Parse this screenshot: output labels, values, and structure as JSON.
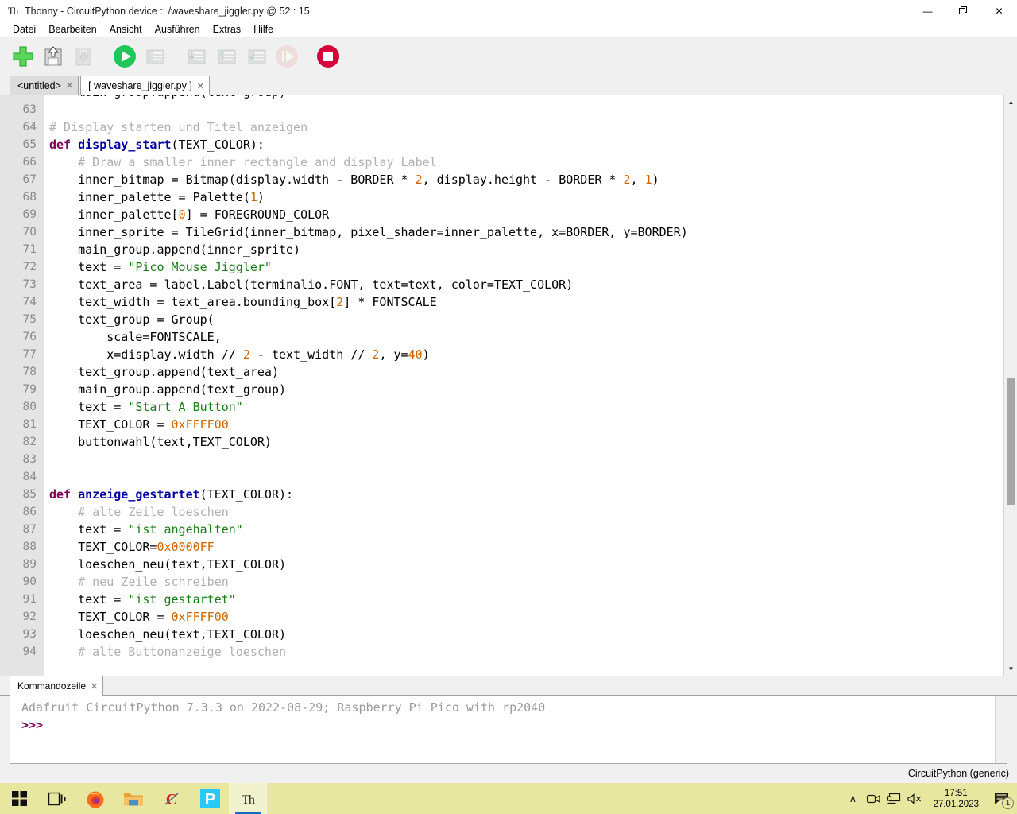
{
  "window": {
    "title": "Thonny  -  CircuitPython device :: /waveshare_jiggler.py  @  52 : 15",
    "app_icon": "thonny-icon",
    "minimize": "—",
    "maximize": "❐",
    "close": "✕"
  },
  "menu": {
    "items": [
      {
        "label": "Datei"
      },
      {
        "label": "Bearbeiten"
      },
      {
        "label": "Ansicht"
      },
      {
        "label": "Ausführen"
      },
      {
        "label": "Extras"
      },
      {
        "label": "Hilfe"
      }
    ]
  },
  "toolbar": {
    "buttons": [
      {
        "name": "new-file-button",
        "icon": "plus-icon",
        "enabled": true
      },
      {
        "name": "open-file-button",
        "icon": "folder-open-icon",
        "enabled": true
      },
      {
        "name": "save-file-button",
        "icon": "save-icon",
        "enabled": false
      },
      {
        "name": "run-button",
        "icon": "play-icon",
        "enabled": true
      },
      {
        "name": "debug-button",
        "icon": "debug-icon",
        "enabled": false
      },
      {
        "name": "step-over-button",
        "icon": "step-over-icon",
        "enabled": false
      },
      {
        "name": "step-into-button",
        "icon": "step-into-icon",
        "enabled": false
      },
      {
        "name": "step-out-button",
        "icon": "step-out-icon",
        "enabled": false
      },
      {
        "name": "resume-button",
        "icon": "resume-icon",
        "enabled": false
      },
      {
        "name": "stop-button",
        "icon": "stop-icon",
        "enabled": true
      }
    ]
  },
  "editor": {
    "tabs": [
      {
        "label": "<untitled>",
        "active": false,
        "close": "✕"
      },
      {
        "label": "[ waveshare_jiggler.py ]",
        "active": true,
        "close": "✕"
      }
    ],
    "first_line_number": 63,
    "clipped_top_line": "    main_group.append(text_group)",
    "lines": [
      {
        "n": 63,
        "tokens": []
      },
      {
        "n": 64,
        "tokens": [
          {
            "t": "# Display starten und Titel anzeigen",
            "c": "cm"
          }
        ]
      },
      {
        "n": 65,
        "tokens": [
          {
            "t": "def ",
            "c": "kw"
          },
          {
            "t": "display_start",
            "c": "fn"
          },
          {
            "t": "(TEXT_COLOR):",
            "c": ""
          }
        ]
      },
      {
        "n": 66,
        "tokens": [
          {
            "t": "    # Draw a smaller inner rectangle and display Label",
            "c": "cm"
          }
        ]
      },
      {
        "n": 67,
        "tokens": [
          {
            "t": "    inner_bitmap = Bitmap(display.width - BORDER * ",
            "c": ""
          },
          {
            "t": "2",
            "c": "nu"
          },
          {
            "t": ", display.height - BORDER * ",
            "c": ""
          },
          {
            "t": "2",
            "c": "nu"
          },
          {
            "t": ", ",
            "c": ""
          },
          {
            "t": "1",
            "c": "nu"
          },
          {
            "t": ")",
            "c": ""
          }
        ]
      },
      {
        "n": 68,
        "tokens": [
          {
            "t": "    inner_palette = Palette(",
            "c": ""
          },
          {
            "t": "1",
            "c": "nu"
          },
          {
            "t": ")",
            "c": ""
          }
        ]
      },
      {
        "n": 69,
        "tokens": [
          {
            "t": "    inner_palette[",
            "c": ""
          },
          {
            "t": "0",
            "c": "nu"
          },
          {
            "t": "] = FOREGROUND_COLOR",
            "c": ""
          }
        ]
      },
      {
        "n": 70,
        "tokens": [
          {
            "t": "    inner_sprite = TileGrid(inner_bitmap, pixel_shader=inner_palette, x=BORDER, y=BORDER)",
            "c": ""
          }
        ]
      },
      {
        "n": 71,
        "tokens": [
          {
            "t": "    main_group.append(inner_sprite)",
            "c": ""
          }
        ]
      },
      {
        "n": 72,
        "tokens": [
          {
            "t": "    text = ",
            "c": ""
          },
          {
            "t": "\"Pico Mouse Jiggler\"",
            "c": "st"
          }
        ]
      },
      {
        "n": 73,
        "tokens": [
          {
            "t": "    text_area = label.Label(terminalio.FONT, text=text, color=TEXT_COLOR)",
            "c": ""
          }
        ]
      },
      {
        "n": 74,
        "tokens": [
          {
            "t": "    text_width = text_area.bounding_box[",
            "c": ""
          },
          {
            "t": "2",
            "c": "nu"
          },
          {
            "t": "] * FONTSCALE",
            "c": ""
          }
        ]
      },
      {
        "n": 75,
        "tokens": [
          {
            "t": "    text_group = Group(",
            "c": ""
          }
        ]
      },
      {
        "n": 76,
        "tokens": [
          {
            "t": "        scale=FONTSCALE,",
            "c": ""
          }
        ]
      },
      {
        "n": 77,
        "tokens": [
          {
            "t": "        x=display.width // ",
            "c": ""
          },
          {
            "t": "2",
            "c": "nu"
          },
          {
            "t": " - text_width // ",
            "c": ""
          },
          {
            "t": "2",
            "c": "nu"
          },
          {
            "t": ", y=",
            "c": ""
          },
          {
            "t": "40",
            "c": "nu"
          },
          {
            "t": ")",
            "c": ""
          }
        ]
      },
      {
        "n": 78,
        "tokens": [
          {
            "t": "    text_group.append(text_area)",
            "c": ""
          }
        ]
      },
      {
        "n": 79,
        "tokens": [
          {
            "t": "    main_group.append(text_group)",
            "c": ""
          }
        ]
      },
      {
        "n": 80,
        "tokens": [
          {
            "t": "    text = ",
            "c": ""
          },
          {
            "t": "\"Start A Button\"",
            "c": "st"
          }
        ]
      },
      {
        "n": 81,
        "tokens": [
          {
            "t": "    TEXT_COLOR = ",
            "c": ""
          },
          {
            "t": "0xFFFF00",
            "c": "nu"
          }
        ]
      },
      {
        "n": 82,
        "tokens": [
          {
            "t": "    buttonwahl(text,TEXT_COLOR)",
            "c": ""
          }
        ]
      },
      {
        "n": 83,
        "tokens": []
      },
      {
        "n": 84,
        "tokens": []
      },
      {
        "n": 85,
        "tokens": [
          {
            "t": "def ",
            "c": "kw"
          },
          {
            "t": "anzeige_gestartet",
            "c": "fn"
          },
          {
            "t": "(TEXT_COLOR):",
            "c": ""
          }
        ]
      },
      {
        "n": 86,
        "tokens": [
          {
            "t": "    # alte Zeile loeschen",
            "c": "cm"
          }
        ]
      },
      {
        "n": 87,
        "tokens": [
          {
            "t": "    text = ",
            "c": ""
          },
          {
            "t": "\"ist angehalten\"",
            "c": "st"
          }
        ]
      },
      {
        "n": 88,
        "tokens": [
          {
            "t": "    TEXT_COLOR=",
            "c": ""
          },
          {
            "t": "0x0000FF",
            "c": "nu"
          }
        ]
      },
      {
        "n": 89,
        "tokens": [
          {
            "t": "    loeschen_neu(text,TEXT_COLOR)",
            "c": ""
          }
        ]
      },
      {
        "n": 90,
        "tokens": [
          {
            "t": "    # neu Zeile schreiben",
            "c": "cm"
          }
        ]
      },
      {
        "n": 91,
        "tokens": [
          {
            "t": "    text = ",
            "c": ""
          },
          {
            "t": "\"ist gestartet\"",
            "c": "st"
          }
        ]
      },
      {
        "n": 92,
        "tokens": [
          {
            "t": "    TEXT_COLOR = ",
            "c": ""
          },
          {
            "t": "0xFFFF00",
            "c": "nu"
          }
        ]
      },
      {
        "n": 93,
        "tokens": [
          {
            "t": "    loeschen_neu(text,TEXT_COLOR)",
            "c": ""
          }
        ]
      },
      {
        "n": 94,
        "tokens": [
          {
            "t": "    # alte Buttonanzeige loeschen",
            "c": "cm"
          }
        ]
      }
    ]
  },
  "shell": {
    "tab_label": "Kommandozeile",
    "tab_close": "✕",
    "banner": "Adafruit CircuitPython 7.3.3 on 2022-08-29; Raspberry Pi Pico with rp2040",
    "prompt": ">>>"
  },
  "statusbar": {
    "interpreter": "CircuitPython (generic)"
  },
  "taskbar": {
    "buttons": [
      {
        "name": "start-button",
        "icon": "windows-logo-icon",
        "active": false,
        "running": false
      },
      {
        "name": "task-view-button",
        "icon": "task-view-icon",
        "active": false,
        "running": false
      },
      {
        "name": "firefox-button",
        "icon": "firefox-icon",
        "active": false,
        "running": true
      },
      {
        "name": "file-explorer-button",
        "icon": "folder-icon",
        "active": false,
        "running": true
      },
      {
        "name": "chrome-c-button",
        "icon": "letter-c-icon",
        "active": false,
        "running": true
      },
      {
        "name": "pdf-button",
        "icon": "letter-p-icon",
        "active": false,
        "running": true
      },
      {
        "name": "thonny-button",
        "icon": "thonny-icon",
        "active": true,
        "running": true
      }
    ],
    "tray": [
      {
        "name": "show-hidden-icons",
        "glyph": "∧"
      },
      {
        "name": "camera-icon",
        "glyph": ""
      },
      {
        "name": "network-display-icon",
        "glyph": ""
      },
      {
        "name": "volume-muted-icon",
        "glyph": ""
      }
    ],
    "clock": {
      "time": "17:51",
      "date": "27.01.2023"
    },
    "notifications": {
      "icon": "notification-icon",
      "count": "1"
    }
  },
  "colors": {
    "accent_green": "#33cc33",
    "stop_red": "#d6003c",
    "keyword": "#7f0055",
    "function": "#0000a0",
    "string": "#1a7a1a",
    "number": "#cc6600",
    "comment": "#b0b0b0",
    "desktop": "#e8e79f"
  }
}
